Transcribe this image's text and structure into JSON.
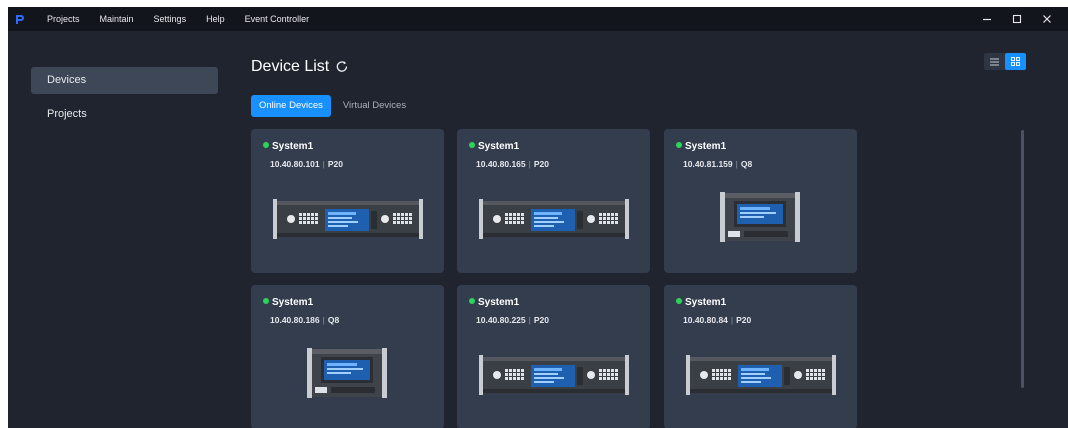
{
  "menu": {
    "items": [
      "Projects",
      "Maintain",
      "Settings",
      "Help",
      "Event Controller"
    ]
  },
  "window_controls": {
    "minimize_icon": "minimize-icon",
    "maximize_icon": "maximize-icon",
    "close_icon": "close-icon"
  },
  "sidebar": {
    "items": [
      {
        "label": "Devices",
        "active": true
      },
      {
        "label": "Projects",
        "active": false
      }
    ]
  },
  "main": {
    "title": "Device List",
    "tabs": [
      {
        "label": "Online Devices",
        "active": true
      },
      {
        "label": "Virtual Devices",
        "active": false
      }
    ],
    "view_toggle": {
      "active": "grid"
    }
  },
  "devices": [
    {
      "name": "System1",
      "ip": "10.40.80.101",
      "model": "P20",
      "status": "online"
    },
    {
      "name": "System1",
      "ip": "10.40.80.165",
      "model": "P20",
      "status": "online"
    },
    {
      "name": "System1",
      "ip": "10.40.81.159",
      "model": "Q8",
      "status": "online"
    },
    {
      "name": "System1",
      "ip": "10.40.80.186",
      "model": "Q8",
      "status": "online"
    },
    {
      "name": "System1",
      "ip": "10.40.80.225",
      "model": "P20",
      "status": "online"
    },
    {
      "name": "System1",
      "ip": "10.40.80.84",
      "model": "P20",
      "status": "online"
    }
  ],
  "colors": {
    "accent": "#1890ff",
    "online": "#2bd45a",
    "card": "#343d4e",
    "background": "#1f242f",
    "menubar": "#12151b"
  }
}
